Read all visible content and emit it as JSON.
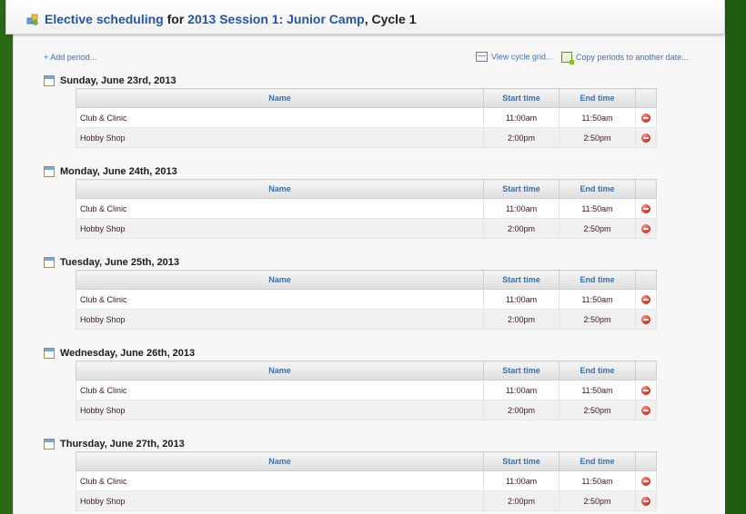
{
  "title": {
    "part1": "Elective scheduling",
    "part2": " for ",
    "part3": "2013 Session 1: Junior Camp",
    "part4": ", Cycle 1"
  },
  "actions": {
    "add_period": "+ Add period...",
    "view_cycle_grid": "View cycle grid...",
    "copy_periods": "Copy periods to another date..."
  },
  "columns": {
    "name": "Name",
    "start": "Start time",
    "end": "End time"
  },
  "days": [
    {
      "title": "Sunday, June 23rd, 2013",
      "rows": [
        {
          "name": "Club & Clinic",
          "start": "11:00am",
          "end": "11:50am"
        },
        {
          "name": "Hobby Shop",
          "start": "2:00pm",
          "end": "2:50pm"
        }
      ]
    },
    {
      "title": "Monday, June 24th, 2013",
      "rows": [
        {
          "name": "Club & Clinic",
          "start": "11:00am",
          "end": "11:50am"
        },
        {
          "name": "Hobby Shop",
          "start": "2:00pm",
          "end": "2:50pm"
        }
      ]
    },
    {
      "title": "Tuesday, June 25th, 2013",
      "rows": [
        {
          "name": "Club & Clinic",
          "start": "11:00am",
          "end": "11:50am"
        },
        {
          "name": "Hobby Shop",
          "start": "2:00pm",
          "end": "2:50pm"
        }
      ]
    },
    {
      "title": "Wednesday, June 26th, 2013",
      "rows": [
        {
          "name": "Club & Clinic",
          "start": "11:00am",
          "end": "11:50am"
        },
        {
          "name": "Hobby Shop",
          "start": "2:00pm",
          "end": "2:50pm"
        }
      ]
    },
    {
      "title": "Thursday, June 27th, 2013",
      "rows": [
        {
          "name": "Club & Clinic",
          "start": "11:00am",
          "end": "11:50am"
        },
        {
          "name": "Hobby Shop",
          "start": "2:00pm",
          "end": "2:50pm"
        }
      ]
    }
  ]
}
